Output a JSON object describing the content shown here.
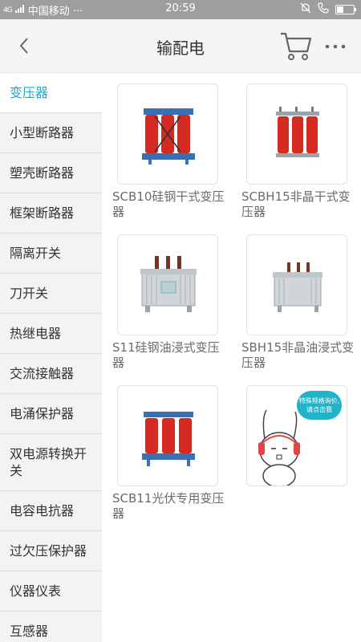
{
  "status_bar": {
    "network": "4G",
    "carrier": "中国移动 ···",
    "time": "20:59"
  },
  "header": {
    "title": "输配电"
  },
  "sidebar": {
    "items": [
      {
        "label": "变压器",
        "active": true
      },
      {
        "label": "小型断路器"
      },
      {
        "label": "塑壳断路器"
      },
      {
        "label": "框架断路器"
      },
      {
        "label": "隔离开关"
      },
      {
        "label": "刀开关"
      },
      {
        "label": "热继电器"
      },
      {
        "label": "交流接触器"
      },
      {
        "label": "电涌保护器"
      },
      {
        "label": "双电源转换开关"
      },
      {
        "label": "电容电抗器"
      },
      {
        "label": "过欠压保护器"
      },
      {
        "label": "仪器仪表"
      },
      {
        "label": "互感器"
      }
    ]
  },
  "products": [
    {
      "name": "SCB10硅钢干式变压器",
      "image": "dry-type-transformer-red"
    },
    {
      "name": "SCBH15非晶干式变压器",
      "image": "amorphous-dry-transformer-red"
    },
    {
      "name": "S11硅钢油浸式变压器",
      "image": "oil-immersed-transformer"
    },
    {
      "name": "SBH15非晶油浸式变压器",
      "image": "amorphous-oil-transformer"
    },
    {
      "name": "SCB11光伏专用变压器",
      "image": "pv-transformer-red"
    },
    {
      "name": "",
      "image": "rabbit-mascot",
      "bubble_text": "特殊规格询价,请点击我"
    }
  ],
  "colors": {
    "accent": "#22a8c8",
    "status_bar": "#9e9e9e",
    "transformer_red": "#d42a22",
    "mascot_bubble": "#22b3c9"
  }
}
